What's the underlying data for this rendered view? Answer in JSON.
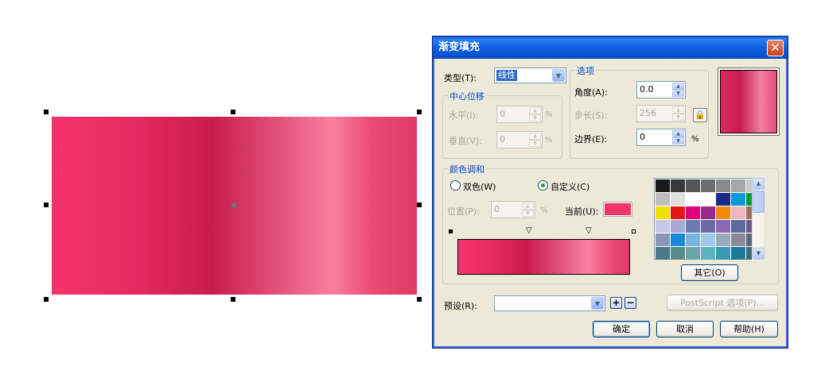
{
  "dialog": {
    "title": "渐变填充",
    "close_glyph": "✕",
    "type_label": "类型(T):",
    "type_value": "线性",
    "center_group": "中心位移",
    "horizontal_label": "水平(I):",
    "horizontal_value": "0",
    "vertical_label": "垂直(V):",
    "vertical_value": "0",
    "percent": "%",
    "options_group": "选项",
    "angle_label": "角度(A):",
    "angle_value": "0.0",
    "steps_label": "步长(S):",
    "steps_value": "256",
    "edge_label": "边界(E):",
    "edge_value": "0",
    "blend_group": "颜色调和",
    "two_color_label": "双色(W)",
    "custom_label": "自定义(C)",
    "position_label": "位置(P):",
    "position_value": "0",
    "current_label": "当前(U):",
    "current_color": "#f5346c",
    "other_button": "其它(O)",
    "preset_label": "预设(R):",
    "preset_value": "",
    "postscript_button": "PostScript 选项(P)...",
    "ok_button": "确定",
    "cancel_button": "取消",
    "help_button": "帮助(H)",
    "add_preset": "+",
    "remove_preset": "−",
    "lock_glyph": "🔒",
    "selection_marker": "×"
  },
  "palette_colors": [
    "#1a1a1a",
    "#383838",
    "#555555",
    "#6d6d6d",
    "#8a8a8a",
    "#a6a6a6",
    "#c8c8c8",
    "#bebebe",
    "#e0e0e0",
    "#ffffff",
    "#ffffff",
    "#1a2a8a",
    "#0a9ad8",
    "#0a9a3a",
    "#f0e000",
    "#e01818",
    "#e0007a",
    "#9a2a8a",
    "#f08a0a",
    "#f0b4bc",
    "#9a7060",
    "#c8c8e8",
    "#aaaad0",
    "#6a7ab4",
    "#6a6aa4",
    "#8a6ab4",
    "#5a6a9a",
    "#6a5a8a",
    "#8a9ab4",
    "#1a8ad8",
    "#7ab4e0",
    "#a0c8e8",
    "#9aaabe",
    "#8a8a9a",
    "#5a6a7a",
    "#4a7a8a",
    "#5a8a8a",
    "#6aa4a4",
    "#5ab4c0",
    "#3a9ab4",
    "#1a7a9a",
    "#3a6a7a"
  ]
}
